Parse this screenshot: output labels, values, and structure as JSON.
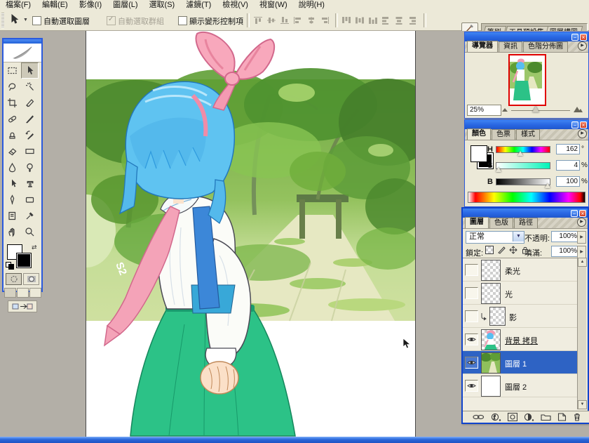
{
  "menu_bar": {
    "items": [
      "檔案(F)",
      "編輯(E)",
      "影像(I)",
      "圖層(L)",
      "選取(S)",
      "濾鏡(T)",
      "檢視(V)",
      "視窗(W)",
      "說明(H)"
    ]
  },
  "options_bar": {
    "tool_icon": "move-tool-icon",
    "auto_select_layer_label": "自動選取圖層",
    "auto_select_layer_checked": false,
    "auto_select_groups_label": "自動選取群組",
    "auto_select_groups_checked": true,
    "auto_select_groups_disabled": true,
    "show_transform_label": "顯示變形控制項",
    "show_transform_checked": false,
    "align_icons": [
      "align-top-edges-icon",
      "align-vertical-centers-icon",
      "align-bottom-edges-icon",
      "align-left-edges-icon",
      "align-horizontal-centers-icon",
      "align-right-edges-icon"
    ],
    "distribute_icons": [
      "distribute-top-edges-icon",
      "distribute-vertical-centers-icon",
      "distribute-bottom-edges-icon",
      "distribute-left-edges-icon",
      "distribute-horizontal-centers-icon",
      "distribute-right-edges-icon"
    ],
    "palette_well_tabs": [
      "筆刷",
      "工具預設集",
      "圖層構圖"
    ]
  },
  "toolbox": {
    "tools": [
      "rectangular-marquee",
      "move",
      "lasso",
      "magic-wand",
      "crop",
      "slice",
      "healing-brush",
      "brush",
      "clone-stamp",
      "history-brush",
      "eraser",
      "gradient",
      "blur",
      "dodge",
      "path-selection",
      "type",
      "pen",
      "shape",
      "notes",
      "eyedropper",
      "hand",
      "zoom"
    ],
    "selected_tool": "move"
  },
  "navigator_panel": {
    "tabs": [
      "導覽器",
      "資訊",
      "色階分佈圖"
    ],
    "active_tab": "導覽器",
    "zoom_value": "25%"
  },
  "color_panel": {
    "tabs": [
      "顏色",
      "色票",
      "樣式"
    ],
    "active_tab": "顏色",
    "sliders": [
      {
        "label": "H",
        "value": "162",
        "unit": "°",
        "position_pct": 45
      },
      {
        "label": "S",
        "value": "4",
        "unit": "%",
        "position_pct": 4
      },
      {
        "label": "B",
        "value": "100",
        "unit": "%",
        "position_pct": 100
      }
    ],
    "foreground_color": "#ffffff",
    "background_color": "#000000"
  },
  "layers_panel": {
    "tabs": [
      "圖層",
      "色版",
      "路徑"
    ],
    "active_tab": "圖層",
    "blend_mode": "正常",
    "opacity_label": "不透明:",
    "opacity_value": "100%",
    "lock_label": "鎖定:",
    "lock_icons": [
      "lock-transparency-icon",
      "lock-paint-icon",
      "lock-position-icon",
      "lock-all-icon"
    ],
    "fill_label": "填滿:",
    "fill_value": "100%",
    "layers": [
      {
        "name": "柔光",
        "visible": false,
        "thumb": "transparent-checker",
        "selected": false,
        "clipped": false
      },
      {
        "name": "光",
        "visible": false,
        "thumb": "transparent-checker",
        "selected": false,
        "clipped": false
      },
      {
        "name": "影",
        "visible": false,
        "thumb": "transparent-checker",
        "selected": false,
        "clipped": true
      },
      {
        "name": "背景 拷貝",
        "visible": true,
        "thumb": "character-art",
        "selected": false,
        "clipped": false
      },
      {
        "name": "圖層 1",
        "visible": true,
        "thumb": "forest-photo",
        "selected": true,
        "clipped": false
      },
      {
        "name": "圖層 2",
        "visible": true,
        "thumb": "white-fill",
        "selected": false,
        "clipped": false
      }
    ],
    "bottom_icons": [
      "link-layers-icon",
      "layer-style-icon",
      "layer-mask-icon",
      "adjustment-layer-icon",
      "new-group-icon",
      "new-layer-icon",
      "delete-layer-icon"
    ]
  },
  "colors": {
    "workspace_gray": "#b3afa7",
    "panel_beige": "#ece9d8",
    "selection_blue": "#2e63c4",
    "titlebar_blue": "#2a68e4",
    "navigator_proxy_red": "#e00000"
  }
}
